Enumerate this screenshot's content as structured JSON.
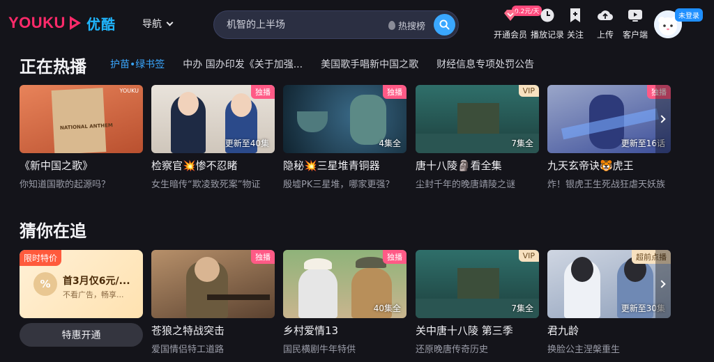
{
  "header": {
    "logo_word": "YOUKU",
    "logo_cn": "优酷",
    "nav_label": "导航",
    "search_placeholder": "机智的上半场",
    "hot_search_label": "热搜榜",
    "vip_badge": "0.2元/天",
    "actions": [
      {
        "name": "vip-icon",
        "label": "开通会员"
      },
      {
        "name": "history-icon",
        "label": "播放记录"
      },
      {
        "name": "bookmark-icon",
        "label": "关注"
      },
      {
        "name": "upload-icon",
        "label": "上传"
      },
      {
        "name": "tv-icon",
        "label": "客户端"
      }
    ],
    "login_tag": "未登录"
  },
  "hot": {
    "title": "正在热播",
    "tabs": [
      "护苗•绿书签",
      "中办 国办印发《关于加强...",
      "美国歌手唱新中国之歌",
      "财经信息专项处罚公告"
    ],
    "cards": [
      {
        "title": "《新中国之歌》",
        "subtitle": "你知道国歌的起源吗？",
        "tag": "",
        "episodes": "",
        "thumb_text": "NATIONAL ANTHEM"
      },
      {
        "title": "检察官💥惨不忍睹",
        "subtitle": "女生暗传“欺凌致死案”物证",
        "tag": "独播",
        "episodes": "更新至40集"
      },
      {
        "title": "隐秘💥三星堆青铜器",
        "subtitle": "殷墟PK三星堆，哪家更强？",
        "tag": "独播",
        "episodes": "4集全"
      },
      {
        "title": "唐十八陵🗿看全集",
        "subtitle": "尘封千年的晚唐靖陵之谜",
        "tag": "VIP",
        "episodes": "7集全"
      },
      {
        "title": "九天玄帝诀🐯虎王",
        "subtitle": "炸！银虎王生死战狂虐天妖族",
        "tag": "独播",
        "episodes": "更新至16话"
      }
    ]
  },
  "follow": {
    "title": "猜你在追",
    "promo": {
      "tag": "限时特价",
      "main": "首3月仅6元/...",
      "sub": "不看广告，畅享...",
      "button": "特惠开通"
    },
    "cards": [
      {
        "title": "苍狼之特战突击",
        "subtitle": "爱国情侣特工道路",
        "tag": "独播",
        "episodes": ""
      },
      {
        "title": "乡村爱情13",
        "subtitle": "国民横剧牛年特供",
        "tag": "独播",
        "episodes": "40集全"
      },
      {
        "title": "关中唐十八陵 第三季",
        "subtitle": "还原晚唐传奇历史",
        "tag": "VIP",
        "episodes": "7集全"
      },
      {
        "title": "君九龄",
        "subtitle": "换脸公主涅槃重生",
        "tag": "超前点播",
        "episodes": "更新至30集"
      }
    ]
  },
  "colors": {
    "brand_pink": "#ff2a6a",
    "brand_blue": "#1fb6ff",
    "accent": "#3aa7ff"
  }
}
